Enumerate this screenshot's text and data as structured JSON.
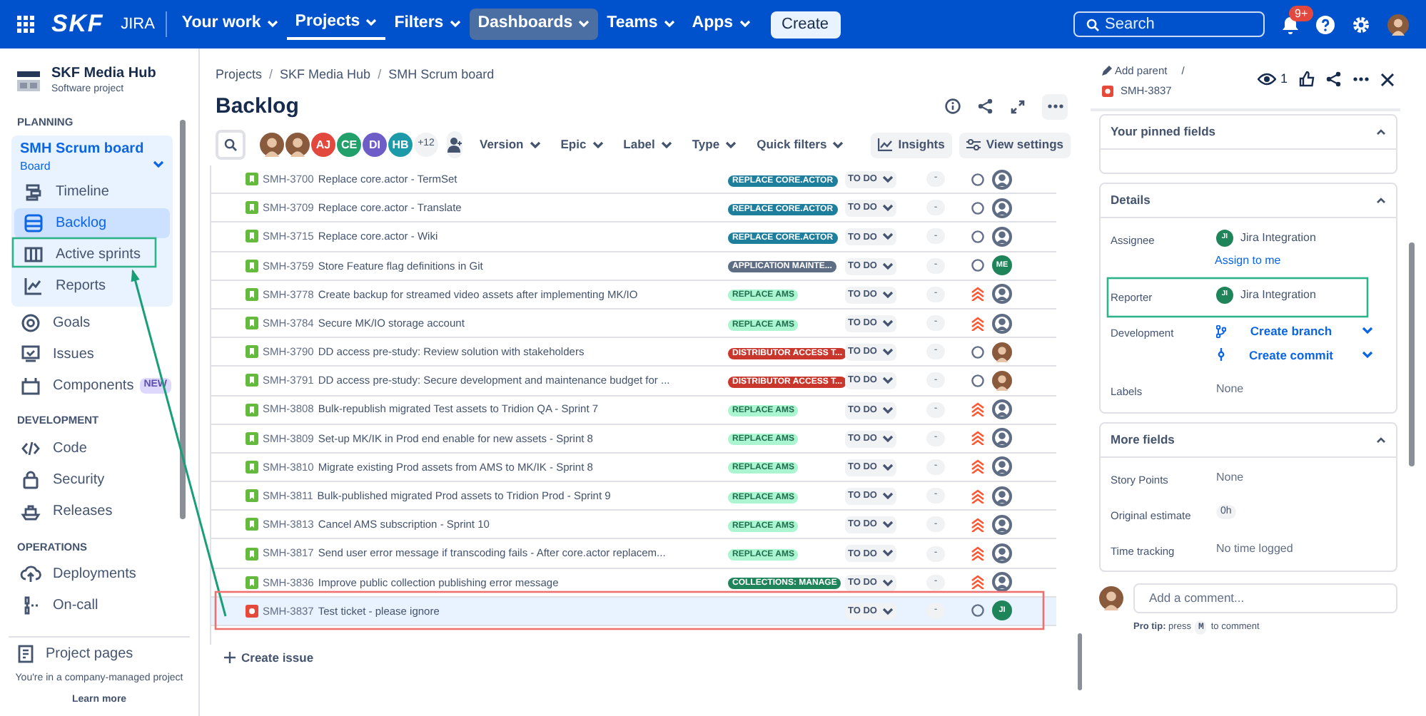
{
  "top_nav": {
    "logo": "SKF",
    "product": "JIRA",
    "menus": [
      {
        "label": "Your work",
        "selected": false,
        "hovered": false
      },
      {
        "label": "Projects",
        "selected": true,
        "hovered": false
      },
      {
        "label": "Filters",
        "selected": false,
        "hovered": false
      },
      {
        "label": "Dashboards",
        "selected": false,
        "hovered": true
      },
      {
        "label": "Teams",
        "selected": false,
        "hovered": false
      },
      {
        "label": "Apps",
        "selected": false,
        "hovered": false
      }
    ],
    "create": "Create",
    "search": {
      "placeholder": "Search"
    },
    "notifications_badge": "9+"
  },
  "sidebar": {
    "project": {
      "name": "SKF Media Hub",
      "type": "Software project"
    },
    "sections": [
      {
        "heading": "PLANNING",
        "board": {
          "title": "SMH Scrum board",
          "subtitle": "Board",
          "expanded": true,
          "items": [
            {
              "label": "Timeline",
              "selected": false
            },
            {
              "label": "Backlog",
              "selected": true
            },
            {
              "label": "Active sprints",
              "selected": false
            },
            {
              "label": "Reports",
              "selected": false
            }
          ]
        },
        "items": [
          {
            "label": "Goals",
            "selected": false
          },
          {
            "label": "Issues",
            "selected": false
          },
          {
            "label": "Components",
            "selected": false,
            "badge": "NEW"
          }
        ]
      },
      {
        "heading": "DEVELOPMENT",
        "items": [
          {
            "label": "Code",
            "selected": false
          },
          {
            "label": "Security",
            "selected": false
          },
          {
            "label": "Releases",
            "selected": false
          }
        ]
      },
      {
        "heading": "OPERATIONS",
        "items": [
          {
            "label": "Deployments",
            "selected": false
          },
          {
            "label": "On-call",
            "selected": false
          }
        ]
      }
    ],
    "footer_link": "Project pages",
    "note": "You're in a company-managed project",
    "learn_more": "Learn more"
  },
  "main": {
    "breadcrumbs": [
      "Projects",
      "/",
      "SKF Media Hub",
      "/",
      "SMH Scrum board"
    ],
    "title": "Backlog",
    "avatars": [
      {
        "kind": "photo"
      },
      {
        "kind": "photo"
      },
      {
        "kind": "initials",
        "text": "AJ",
        "color": "#e2483d"
      },
      {
        "kind": "initials",
        "text": "CE",
        "color": "#22a06b"
      },
      {
        "kind": "initials",
        "text": "DI",
        "color": "#6e5dc6"
      },
      {
        "kind": "initials",
        "text": "HB",
        "color": "#1d9aaa"
      },
      {
        "kind": "more",
        "text": "+12"
      }
    ],
    "filters": [
      "Version",
      "Epic",
      "Label",
      "Type",
      "Quick filters"
    ],
    "insights": "Insights",
    "view_settings": "View settings",
    "issues": [
      {
        "kind": "story",
        "key": "SMH-3700",
        "summary": "Replace core.actor - TermSet",
        "epic": {
          "label": "REPLACE CORE.ACTOR",
          "color": "#1d7f9c"
        },
        "status": "TO DO",
        "estimate": "-",
        "highest_priority": false,
        "assignee": {
          "kind": "unassigned"
        },
        "selected": false
      },
      {
        "kind": "story",
        "key": "SMH-3709",
        "summary": "Replace core.actor - Translate",
        "epic": {
          "label": "REPLACE CORE.ACTOR",
          "color": "#1d7f9c"
        },
        "status": "TO DO",
        "estimate": "-",
        "highest_priority": false,
        "assignee": {
          "kind": "unassigned"
        },
        "selected": false
      },
      {
        "kind": "story",
        "key": "SMH-3715",
        "summary": "Replace core.actor - Wiki",
        "epic": {
          "label": "REPLACE CORE.ACTOR",
          "color": "#1d7f9c"
        },
        "status": "TO DO",
        "estimate": "-",
        "highest_priority": false,
        "assignee": {
          "kind": "unassigned"
        },
        "selected": false
      },
      {
        "kind": "story",
        "key": "SMH-3759",
        "summary": "Store Feature flag definitions in Git",
        "epic": {
          "label": "APPLICATION MAINTE...",
          "color": "#5e6c84"
        },
        "status": "TO DO",
        "estimate": "-",
        "highest_priority": false,
        "assignee": {
          "kind": "initials",
          "text": "ME",
          "color": "#1f845a"
        },
        "selected": false
      },
      {
        "kind": "story",
        "key": "SMH-3778",
        "summary": "Create backup for streamed video assets after implementing MK/IO",
        "epic": {
          "label": "REPLACE AMS",
          "color": "#abf5d1"
        },
        "status": "TO DO",
        "estimate": "-",
        "highest_priority": true,
        "assignee": {
          "kind": "unassigned"
        },
        "selected": false
      },
      {
        "kind": "story",
        "key": "SMH-3784",
        "summary": "Secure MK/IO storage account",
        "epic": {
          "label": "REPLACE AMS",
          "color": "#abf5d1"
        },
        "status": "TO DO",
        "estimate": "-",
        "highest_priority": true,
        "assignee": {
          "kind": "unassigned"
        },
        "selected": false
      },
      {
        "kind": "story",
        "key": "SMH-3790",
        "summary": "DD access pre-study: Review solution with stakeholders",
        "epic": {
          "label": "DISTRIBUTOR ACCESS T...",
          "color": "#c9372c"
        },
        "status": "TO DO",
        "estimate": "-",
        "highest_priority": false,
        "assignee": {
          "kind": "photo"
        },
        "selected": false
      },
      {
        "kind": "story",
        "key": "SMH-3791",
        "summary": "DD access pre-study: Secure development and maintenance budget for ...",
        "epic": {
          "label": "DISTRIBUTOR ACCESS T...",
          "color": "#c9372c"
        },
        "status": "TO DO",
        "estimate": "-",
        "highest_priority": false,
        "assignee": {
          "kind": "photo"
        },
        "selected": false
      },
      {
        "kind": "story",
        "key": "SMH-3808",
        "summary": "Bulk-republish migrated Test assets to Tridion QA - Sprint 7",
        "epic": {
          "label": "REPLACE AMS",
          "color": "#abf5d1"
        },
        "status": "TO DO",
        "estimate": "-",
        "highest_priority": true,
        "assignee": {
          "kind": "unassigned"
        },
        "selected": false
      },
      {
        "kind": "story",
        "key": "SMH-3809",
        "summary": "Set-up MK/IK in Prod end enable for new assets - Sprint 8",
        "epic": {
          "label": "REPLACE AMS",
          "color": "#abf5d1"
        },
        "status": "TO DO",
        "estimate": "-",
        "highest_priority": true,
        "assignee": {
          "kind": "unassigned"
        },
        "selected": false
      },
      {
        "kind": "story",
        "key": "SMH-3810",
        "summary": "Migrate existing Prod assets from AMS to MK/IK - Sprint 8",
        "epic": {
          "label": "REPLACE AMS",
          "color": "#abf5d1"
        },
        "status": "TO DO",
        "estimate": "-",
        "highest_priority": true,
        "assignee": {
          "kind": "unassigned"
        },
        "selected": false
      },
      {
        "kind": "story",
        "key": "SMH-3811",
        "summary": "Bulk-published migrated Prod assets to Tridion Prod - Sprint 9",
        "epic": {
          "label": "REPLACE AMS",
          "color": "#abf5d1"
        },
        "status": "TO DO",
        "estimate": "-",
        "highest_priority": true,
        "assignee": {
          "kind": "unassigned"
        },
        "selected": false
      },
      {
        "kind": "story",
        "key": "SMH-3813",
        "summary": "Cancel AMS subscription - Sprint 10",
        "epic": {
          "label": "REPLACE AMS",
          "color": "#abf5d1"
        },
        "status": "TO DO",
        "estimate": "-",
        "highest_priority": true,
        "assignee": {
          "kind": "unassigned"
        },
        "selected": false
      },
      {
        "kind": "story",
        "key": "SMH-3817",
        "summary": "Send user error message if transcoding fails - After core.actor replacem...",
        "epic": {
          "label": "REPLACE AMS",
          "color": "#abf5d1"
        },
        "status": "TO DO",
        "estimate": "-",
        "highest_priority": true,
        "assignee": {
          "kind": "unassigned"
        },
        "selected": false
      },
      {
        "kind": "story",
        "key": "SMH-3836",
        "summary": "Improve public collection publishing error message",
        "epic": {
          "label": "COLLECTIONS: MANAGE",
          "color": "#1f845a"
        },
        "status": "TO DO",
        "estimate": "-",
        "highest_priority": true,
        "assignee": {
          "kind": "unassigned"
        },
        "selected": false
      },
      {
        "kind": "bug",
        "key": "SMH-3837",
        "summary": "Test ticket - please ignore",
        "status": "TO DO",
        "estimate": "-",
        "highest_priority": false,
        "assignee": {
          "kind": "initials",
          "text": "JI",
          "color": "#1f845a"
        },
        "selected": true
      }
    ],
    "create_issue": "Create issue"
  },
  "detail": {
    "add_parent": "Add parent",
    "separator": "/",
    "key": "SMH-3837",
    "kind": "bug",
    "watchers": "1",
    "sections": [
      {
        "title": "Your pinned fields",
        "expanded": true
      },
      {
        "title": "Details",
        "expanded": true,
        "fields": [
          {
            "kind": "person",
            "label": "Assignee",
            "value": "Jira Integration",
            "initials": "JI",
            "link": "Assign to me"
          },
          {
            "kind": "person",
            "label": "Reporter",
            "value": "Jira Integration",
            "initials": "JI"
          },
          {
            "kind": "dev",
            "label": "Development",
            "actions": [
              "Create branch",
              "Create commit"
            ]
          },
          {
            "kind": "text",
            "label": "Labels",
            "value": "None"
          }
        ]
      },
      {
        "title": "More fields",
        "expanded": true,
        "fields": [
          {
            "kind": "text",
            "label": "Story Points",
            "value": "None"
          },
          {
            "kind": "pill",
            "label": "Original estimate",
            "value": "0h"
          },
          {
            "kind": "text",
            "label": "Time tracking",
            "value": "No time logged"
          }
        ]
      }
    ],
    "comment_placeholder": "Add a comment...",
    "pro_tip": "**Pro tip:** press",
    "pro_tip_key": "M",
    "pro_tip_end": "to comment"
  }
}
